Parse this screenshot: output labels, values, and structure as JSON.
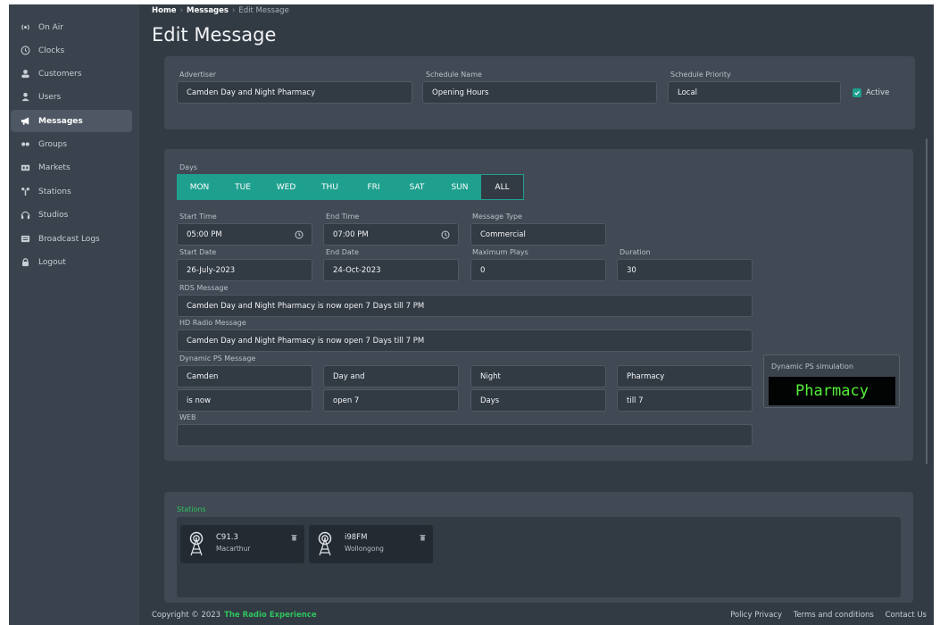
{
  "sidebar": {
    "items": [
      {
        "label": "On Air",
        "icon": "broadcast-icon"
      },
      {
        "label": "Clocks",
        "icon": "clock-icon"
      },
      {
        "label": "Customers",
        "icon": "customers-icon"
      },
      {
        "label": "Users",
        "icon": "user-icon"
      },
      {
        "label": "Messages",
        "icon": "megaphone-icon",
        "active": true
      },
      {
        "label": "Groups",
        "icon": "groups-icon"
      },
      {
        "label": "Markets",
        "icon": "markets-icon"
      },
      {
        "label": "Stations",
        "icon": "stations-icon"
      },
      {
        "label": "Studios",
        "icon": "headphones-icon"
      },
      {
        "label": "Broadcast Logs",
        "icon": "logs-icon"
      },
      {
        "label": "Logout",
        "icon": "lock-icon"
      }
    ]
  },
  "breadcrumb": {
    "home": "Home",
    "messages": "Messages",
    "current": "Edit Message"
  },
  "page": {
    "title": "Edit Message"
  },
  "header_form": {
    "advertiser_label": "Advertiser",
    "advertiser_value": "Camden Day and Night Pharmacy",
    "schedule_name_label": "Schedule Name",
    "schedule_name_value": "Opening Hours",
    "schedule_priority_label": "Schedule Priority",
    "schedule_priority_value": "Local",
    "active_label": "Active"
  },
  "schedule": {
    "days_label": "Days",
    "days": [
      "MON",
      "TUE",
      "WED",
      "THU",
      "FRI",
      "SAT",
      "SUN",
      "ALL"
    ],
    "start_time_label": "Start Time",
    "start_time_value": "05:00 PM",
    "end_time_label": "End Time",
    "end_time_value": "07:00 PM",
    "message_type_label": "Message Type",
    "message_type_value": "Commercial",
    "start_date_label": "Start Date",
    "start_date_value": "26-July-2023",
    "end_date_label": "End Date",
    "end_date_value": "24-Oct-2023",
    "max_plays_label": "Maximum Plays",
    "max_plays_value": "0",
    "duration_label": "Duration",
    "duration_value": "30",
    "rds_label": "RDS Message",
    "rds_value": "Camden Day and Night Pharmacy is now open 7 Days till 7 PM",
    "hd_label": "HD Radio Message",
    "hd_value": "Camden Day and Night Pharmacy is now open 7 Days till 7 PM",
    "dps_label": "Dynamic PS Message",
    "dps_values": [
      "Camden",
      "Day and",
      "Night",
      "Pharmacy",
      "is now",
      "open 7",
      "Days",
      "till 7"
    ],
    "web_label": "WEB",
    "web_value": "",
    "sim_label": "Dynamic PS simulation",
    "sim_value": "Pharmacy"
  },
  "stations": {
    "label": "Stations",
    "items": [
      {
        "name": "C91.3",
        "location": "Macarthur"
      },
      {
        "name": "i98FM",
        "location": "Wollongong"
      }
    ]
  },
  "footer": {
    "copyright": "Copyright © 2023",
    "brand": "The Radio Experience",
    "links": [
      "Policy Privacy",
      "Terms and conditions",
      "Contact Us"
    ]
  },
  "colors": {
    "accent": "#1fa08e",
    "brand_green": "#2ec45d",
    "sim_text": "#55ef3a",
    "background": "#323a44",
    "card": "#404954"
  }
}
